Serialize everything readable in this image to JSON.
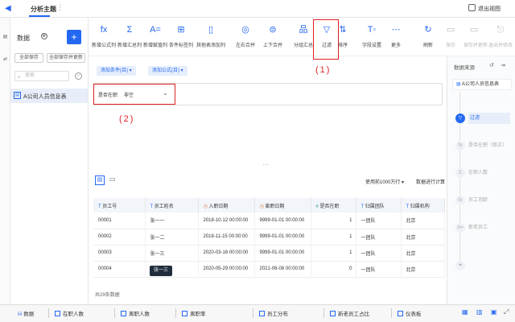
{
  "topbar": {
    "title": "分析主题",
    "exit_label": "退出视图"
  },
  "left": {
    "header": "数据",
    "save_all": "全部保存",
    "save_all_update": "全部保存并更新",
    "search_placeholder": "搜索",
    "table_name": "A公司人员信息表"
  },
  "toolbar": {
    "items": [
      {
        "icon": "fx",
        "label": "新增公式列"
      },
      {
        "icon": "Σ",
        "label": "新增汇总列"
      },
      {
        "icon": "A=",
        "label": "新增赋值列"
      },
      {
        "icon": "⊞",
        "label": "条件标签列"
      },
      {
        "icon": "▯",
        "label": "其他表添加列"
      },
      {
        "icon": "◎",
        "label": "左右合并"
      },
      {
        "icon": "⊜",
        "label": "上下合并"
      },
      {
        "icon": "品",
        "label": "分组汇总"
      },
      {
        "icon": "▽",
        "label": "过滤"
      },
      {
        "icon": "⇅",
        "label": "排序"
      },
      {
        "icon": "T◦",
        "label": "字段设置"
      },
      {
        "icon": "⋯",
        "label": "更多"
      },
      {
        "icon": "↻",
        "label": "刷新"
      },
      {
        "icon": "▭",
        "label": "保存"
      },
      {
        "icon": "▭",
        "label": "保存并更新"
      },
      {
        "icon": "⎋",
        "label": "退出并修改"
      }
    ]
  },
  "annotations": {
    "label1": "(1)",
    "label2": "(2)"
  },
  "filters": {
    "add_condition": "添加条件(且)",
    "add_formula": "添加公式(且)",
    "condition_field": "是否在职",
    "condition_op": "非空"
  },
  "tabletools": {
    "use_label": "使用",
    "row_limit": "前1000万行",
    "data_update": "数据进行计算"
  },
  "grid": {
    "headers": [
      {
        "type": "T",
        "name": "员工号"
      },
      {
        "type": "T",
        "name": "员工姓名"
      },
      {
        "type": "◷",
        "name": "入职日期"
      },
      {
        "type": "◷",
        "name": "离职日期"
      },
      {
        "type": "#",
        "name": "是否在职"
      },
      {
        "type": "T",
        "name": "归属团队"
      },
      {
        "type": "T",
        "name": "归属机构"
      }
    ],
    "rows": [
      [
        "00001",
        "张一一",
        "2018-10-12 00:00:00",
        "9999-01-01 00:00:00",
        "1",
        "一团队",
        "北京"
      ],
      [
        "00002",
        "张一二",
        "2018-11-15 00:00:00",
        "9999-01-01 00:00:00",
        "1",
        "一团队",
        "北京"
      ],
      [
        "00003",
        "张一三",
        "2020-03-16 00:00:00",
        "9999-01-01 00:00:00",
        "1",
        "一团队",
        "北京"
      ],
      [
        "00004",
        "张一四",
        "2020-05-29 00:00:00",
        "2021-06-08 00:00:00",
        "0",
        "一团队",
        "北京"
      ]
    ],
    "tooltip": "张一三",
    "total": "共29条数据"
  },
  "right": {
    "title": "数据来源",
    "source": "A公司人员信息表",
    "steps": [
      {
        "label": "过滤",
        "active": true
      },
      {
        "label": "是否在职（修正）",
        "active": false
      },
      {
        "label": "在职人数",
        "active": false
      },
      {
        "label": "员工司龄",
        "active": false
      },
      {
        "label": "新老员工",
        "active": false
      }
    ]
  },
  "bottom": {
    "data_tab": "数据",
    "tabs": [
      "在职人数",
      "离职人数",
      "离职率",
      "员工分布",
      "新老员工占比",
      "仪表板"
    ]
  },
  "colors": {
    "accent": "#2468f2",
    "annotation": "#e02020"
  }
}
